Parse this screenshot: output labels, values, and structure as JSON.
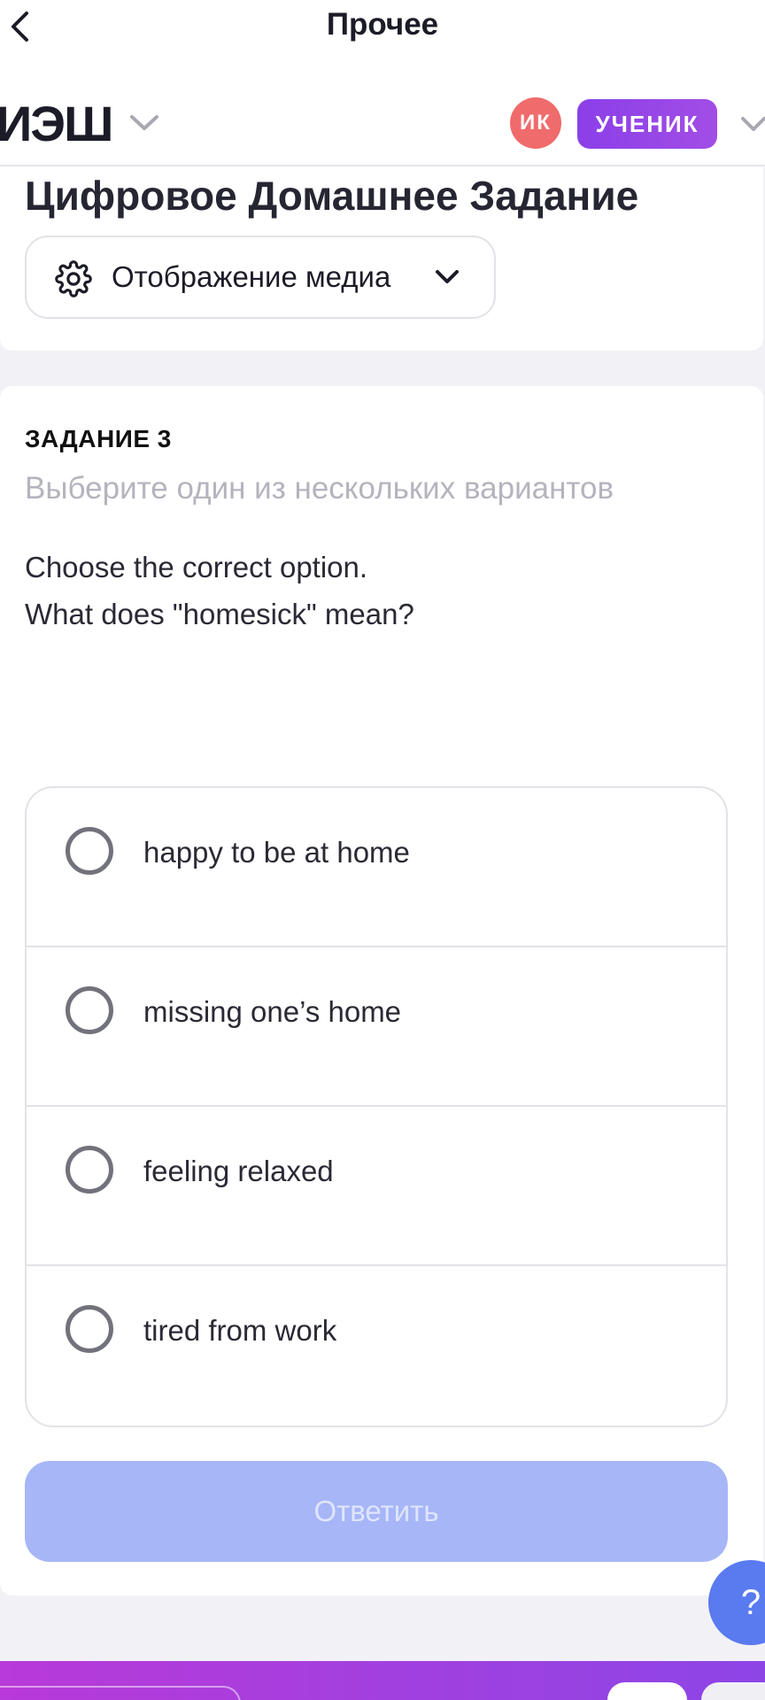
{
  "topbar": {
    "title": "Прочее",
    "back_icon": "chevron-left-icon"
  },
  "header": {
    "logo": "ИЭШ",
    "avatar_initials": "ИК",
    "role": "УЧЕНИК",
    "colors": {
      "avatar": "#f06b6b",
      "role_badge": "#9a46e7"
    }
  },
  "page": {
    "title": "Цифровое Домашнее Задание",
    "media_select": {
      "label": "Отображение медиа",
      "icon": "gear-icon"
    }
  },
  "task": {
    "label": "ЗАДАНИЕ 3",
    "hint": "Выберите один из нескольких вариантов",
    "question_lines": [
      "Choose the correct option.",
      "What does \"homesick\" mean?"
    ],
    "options": [
      {
        "label": "happy to be at home",
        "selected": false
      },
      {
        "label": "missing one’s home",
        "selected": false
      },
      {
        "label": "feeling relaxed",
        "selected": false
      },
      {
        "label": "tired from work",
        "selected": false
      }
    ],
    "answer_label": "Ответить"
  },
  "help": {
    "label": "?"
  },
  "colors": {
    "accent": "#5a7af0",
    "answer_disabled": "#a6b6f7",
    "bottom_bar": "#a33fdf"
  }
}
